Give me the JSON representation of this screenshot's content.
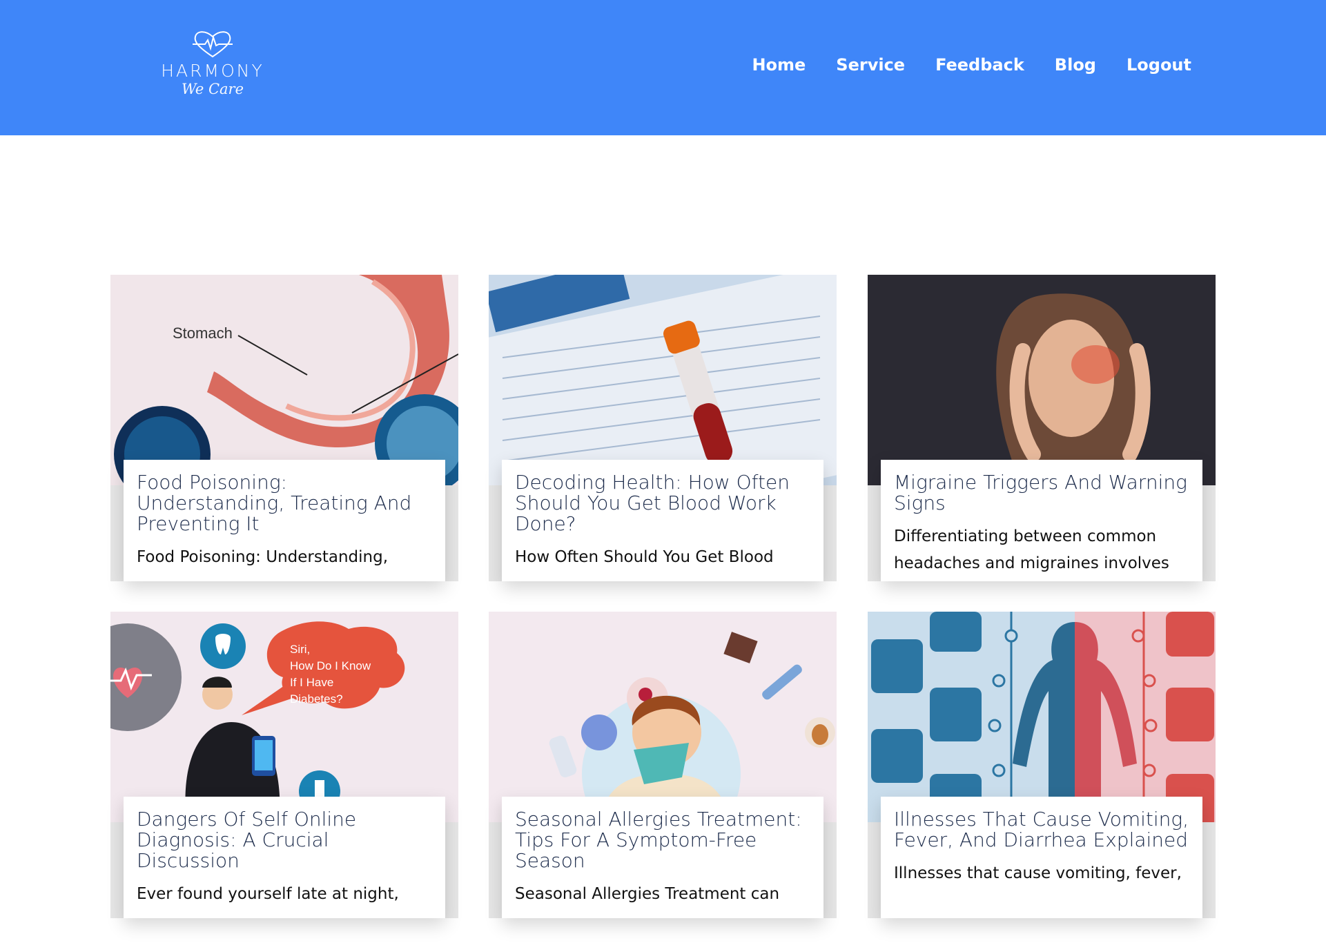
{
  "header": {
    "logo_name": "HARMONY",
    "logo_tagline": "We Care",
    "background": "#3f86f9",
    "nav": [
      {
        "label": "Home"
      },
      {
        "label": "Service"
      },
      {
        "label": "Feedback"
      },
      {
        "label": "Blog"
      },
      {
        "label": "Logout"
      }
    ]
  },
  "posts": [
    {
      "title": "Food Poisoning: Understanding, Treating And Preventing It",
      "excerpt": "Food Poisoning: Understanding,",
      "image_label": "Stomach",
      "icon": "stomach-illustration"
    },
    {
      "title": "Decoding Health: How Often Should You Get Blood Work Done?",
      "excerpt": "How Often Should You Get Blood",
      "image_label": "",
      "icon": "blood-test-tube-photo"
    },
    {
      "title": "Migraine Triggers And Warning Signs",
      "excerpt": "Differentiating between common headaches and migraines involves",
      "image_label": "",
      "icon": "woman-headache-photo"
    },
    {
      "title": "Dangers Of Self Online Diagnosis: A Crucial Discussion",
      "excerpt": "Ever found yourself late at night,",
      "image_label": "Siri, How Do I Know If I Have Diabetes?",
      "icon": "man-with-phone-illustration"
    },
    {
      "title": "Seasonal Allergies Treatment: Tips For A Symptom-Free Season",
      "excerpt": "Seasonal Allergies Treatment can",
      "image_label": "",
      "icon": "sneezing-boy-illustration"
    },
    {
      "title": "Illnesses That Cause Vomiting, Fever, And Diarrhea Explained",
      "excerpt": "Illnesses that cause vomiting, fever,",
      "image_label": "",
      "icon": "symptoms-infographic"
    }
  ]
}
